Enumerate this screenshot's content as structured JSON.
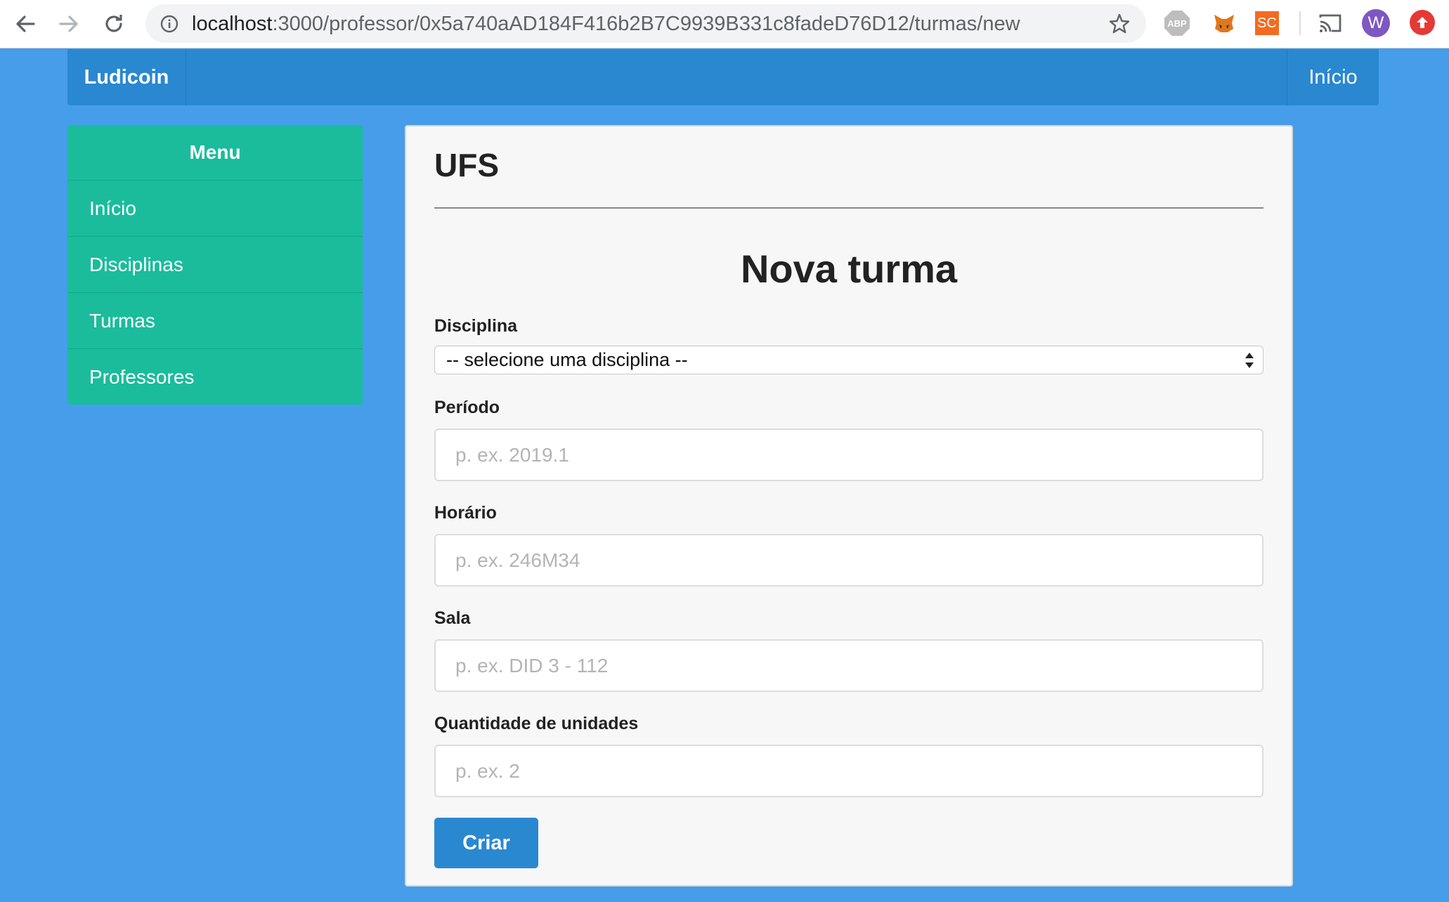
{
  "browser": {
    "url_host": "localhost",
    "url_rest": ":3000/professor/0x5a740aAD184F416b2B7C9939B331c8fadeD76D12/turmas/new",
    "extensions": {
      "abp_label": "ABP",
      "sc_label": "SC",
      "avatar_letter": "W"
    }
  },
  "navbar": {
    "brand": "Ludicoin",
    "home_link": "Início"
  },
  "sidebar": {
    "heading": "Menu",
    "items": [
      {
        "label": "Início"
      },
      {
        "label": "Disciplinas"
      },
      {
        "label": "Turmas"
      },
      {
        "label": "Professores"
      }
    ]
  },
  "panel": {
    "title": "UFS",
    "form_title": "Nova turma",
    "fields": {
      "disciplina": {
        "label": "Disciplina",
        "selected": "-- selecione uma disciplina --"
      },
      "periodo": {
        "label": "Período",
        "placeholder": "p. ex. 2019.1",
        "value": ""
      },
      "horario": {
        "label": "Horário",
        "placeholder": "p. ex. 246M34",
        "value": ""
      },
      "sala": {
        "label": "Sala",
        "placeholder": "p. ex. DID 3 - 112",
        "value": ""
      },
      "unidades": {
        "label": "Quantidade de unidades",
        "placeholder": "p. ex. 2",
        "value": ""
      }
    },
    "submit_label": "Criar"
  },
  "colors": {
    "page_bg": "#469de9",
    "navbar_bg": "#2a88d0",
    "sidebar_bg": "#1abc9c",
    "panel_bg": "#f7f7f7",
    "button_bg": "#2a88d0"
  }
}
